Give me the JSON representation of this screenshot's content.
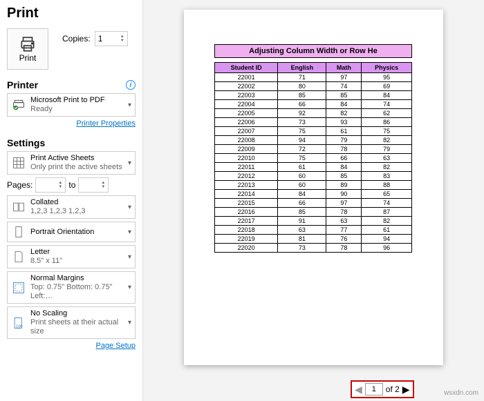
{
  "title": "Print",
  "print_button": "Print",
  "copies_label": "Copies:",
  "copies_value": "1",
  "printer_header": "Printer",
  "printer": {
    "name": "Microsoft Print to PDF",
    "status": "Ready"
  },
  "printer_properties_link": "Printer Properties",
  "settings_header": "Settings",
  "print_active": {
    "title": "Print Active Sheets",
    "sub": "Only print the active sheets"
  },
  "pages_label": "Pages:",
  "pages_to": "to",
  "pages_from": "",
  "pages_to_val": "",
  "collated": {
    "title": "Collated",
    "sub": "1,2,3    1,2,3    1,2,3"
  },
  "orientation": "Portrait Orientation",
  "paper": {
    "title": "Letter",
    "sub": "8.5\" x 11\""
  },
  "margins": {
    "title": "Normal Margins",
    "sub": "Top: 0.75\" Bottom: 0.75\" Left:…"
  },
  "scaling": {
    "title": "No Scaling",
    "sub": "Print sheets at their actual size"
  },
  "page_setup_link": "Page Setup",
  "preview": {
    "banner": "Adjusting Column Width or Row He",
    "headers": [
      "Student ID",
      "English",
      "Math",
      "Physics"
    ],
    "rows": [
      [
        "22001",
        "71",
        "97",
        "95"
      ],
      [
        "22002",
        "80",
        "74",
        "69"
      ],
      [
        "22003",
        "85",
        "85",
        "84"
      ],
      [
        "22004",
        "66",
        "84",
        "74"
      ],
      [
        "22005",
        "92",
        "82",
        "62"
      ],
      [
        "22006",
        "73",
        "93",
        "86"
      ],
      [
        "22007",
        "75",
        "61",
        "75"
      ],
      [
        "22008",
        "94",
        "79",
        "82"
      ],
      [
        "22009",
        "72",
        "78",
        "79"
      ],
      [
        "22010",
        "75",
        "66",
        "63"
      ],
      [
        "22011",
        "61",
        "84",
        "82"
      ],
      [
        "22012",
        "60",
        "85",
        "83"
      ],
      [
        "22013",
        "60",
        "89",
        "88"
      ],
      [
        "22014",
        "84",
        "90",
        "65"
      ],
      [
        "22015",
        "66",
        "97",
        "74"
      ],
      [
        "22016",
        "85",
        "78",
        "87"
      ],
      [
        "22017",
        "91",
        "63",
        "82"
      ],
      [
        "22018",
        "63",
        "77",
        "61"
      ],
      [
        "22019",
        "81",
        "76",
        "94"
      ],
      [
        "22020",
        "73",
        "78",
        "96"
      ]
    ]
  },
  "pager": {
    "current": "1",
    "of_label": "of 2"
  },
  "watermark": "wsxdn.com",
  "chart_data": {
    "type": "table",
    "title": "Adjusting Column Width or Row He",
    "columns": [
      "Student ID",
      "English",
      "Math",
      "Physics"
    ],
    "rows": [
      [
        22001,
        71,
        97,
        95
      ],
      [
        22002,
        80,
        74,
        69
      ],
      [
        22003,
        85,
        85,
        84
      ],
      [
        22004,
        66,
        84,
        74
      ],
      [
        22005,
        92,
        82,
        62
      ],
      [
        22006,
        73,
        93,
        86
      ],
      [
        22007,
        75,
        61,
        75
      ],
      [
        22008,
        94,
        79,
        82
      ],
      [
        22009,
        72,
        78,
        79
      ],
      [
        22010,
        75,
        66,
        63
      ],
      [
        22011,
        61,
        84,
        82
      ],
      [
        22012,
        60,
        85,
        83
      ],
      [
        22013,
        60,
        89,
        88
      ],
      [
        22014,
        84,
        90,
        65
      ],
      [
        22015,
        66,
        97,
        74
      ],
      [
        22016,
        85,
        78,
        87
      ],
      [
        22017,
        91,
        63,
        82
      ],
      [
        22018,
        63,
        77,
        61
      ],
      [
        22019,
        81,
        76,
        94
      ],
      [
        22020,
        73,
        78,
        96
      ]
    ]
  }
}
